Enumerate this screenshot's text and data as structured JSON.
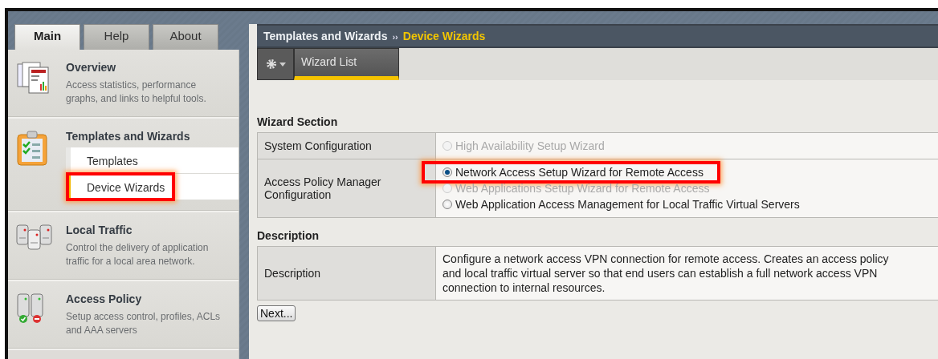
{
  "tabs": [
    {
      "label": "Main",
      "selected": true
    },
    {
      "label": "Help",
      "selected": false
    },
    {
      "label": "About",
      "selected": false
    }
  ],
  "sidebar": {
    "items": [
      {
        "kind": "overview",
        "title": "Overview",
        "description": "Access statistics, performance graphs, and links to helpful tools."
      },
      {
        "kind": "templates",
        "title": "Templates and Wizards",
        "children": [
          {
            "label": "Templates",
            "selected": false,
            "highlighted": false
          },
          {
            "label": "Device Wizards",
            "selected": true,
            "highlighted": true
          }
        ]
      },
      {
        "kind": "local_traffic",
        "title": "Local Traffic",
        "description": "Control the delivery of application traffic for a local area network."
      },
      {
        "kind": "access_policy",
        "title": "Access Policy",
        "description": "Setup access control, profiles, ACLs and AAA servers"
      }
    ]
  },
  "breadcrumb": {
    "parent": "Templates and Wizards",
    "separator": "››",
    "current": "Device Wizards"
  },
  "toolbar": {
    "tabs": [
      {
        "label": "Wizard List",
        "selected": true
      }
    ]
  },
  "sections": [
    {
      "heading": "Wizard Section",
      "rows": [
        {
          "kind": "radios",
          "label": "System Configuration",
          "options": [
            {
              "label": "High Availability Setup Wizard",
              "selected": false,
              "disabled": true,
              "highlighted": false
            }
          ]
        },
        {
          "kind": "radios",
          "label": "Access Policy Manager Configuration",
          "options": [
            {
              "label": "Network Access Setup Wizard for Remote Access",
              "selected": true,
              "disabled": false,
              "highlighted": true
            },
            {
              "label": "Web Applications Setup Wizard for Remote Access",
              "selected": false,
              "disabled": true,
              "highlighted": false
            },
            {
              "label": "Web Application Access Management for Local Traffic Virtual Servers",
              "selected": false,
              "disabled": false,
              "highlighted": false
            }
          ]
        }
      ]
    },
    {
      "heading": "Description",
      "rows": [
        {
          "kind": "text",
          "label": "Description",
          "text": "Configure a network access VPN connection for remote access. Creates an access policy and local traffic virtual server so that end users can establish a full network access VPN connection to internal resources."
        }
      ]
    }
  ],
  "buttons": [
    "Next..."
  ]
}
